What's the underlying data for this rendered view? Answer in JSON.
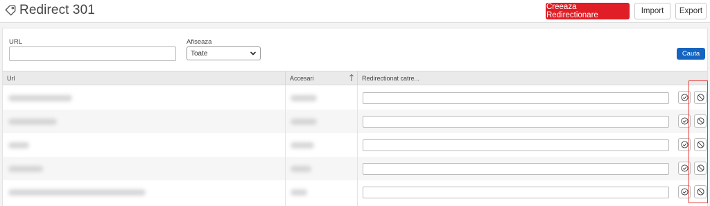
{
  "header": {
    "title": "Redirect 301",
    "title_icon": "tag-icon",
    "create_label": "Creeaza Redirectionare",
    "import_label": "Import",
    "export_label": "Export",
    "accent": "#e01e26"
  },
  "filters": {
    "url_label": "URL",
    "url_value": "",
    "show_label": "Afiseaza",
    "show_selected": "Toate",
    "search_label": "Cauta"
  },
  "table": {
    "columns": [
      "Url",
      "Accesari",
      "Redirectionat catre..."
    ],
    "sort_icon": "sort-up-icon",
    "rows": [
      {
        "url": "",
        "hits": "",
        "redirect": ""
      },
      {
        "url": "",
        "hits": "",
        "redirect": ""
      },
      {
        "url": "",
        "hits": "",
        "redirect": ""
      },
      {
        "url": "",
        "hits": "",
        "redirect": ""
      },
      {
        "url": "",
        "hits": "",
        "redirect": ""
      }
    ],
    "row_action_icons": [
      "check-circle-icon",
      "block-icon"
    ]
  }
}
